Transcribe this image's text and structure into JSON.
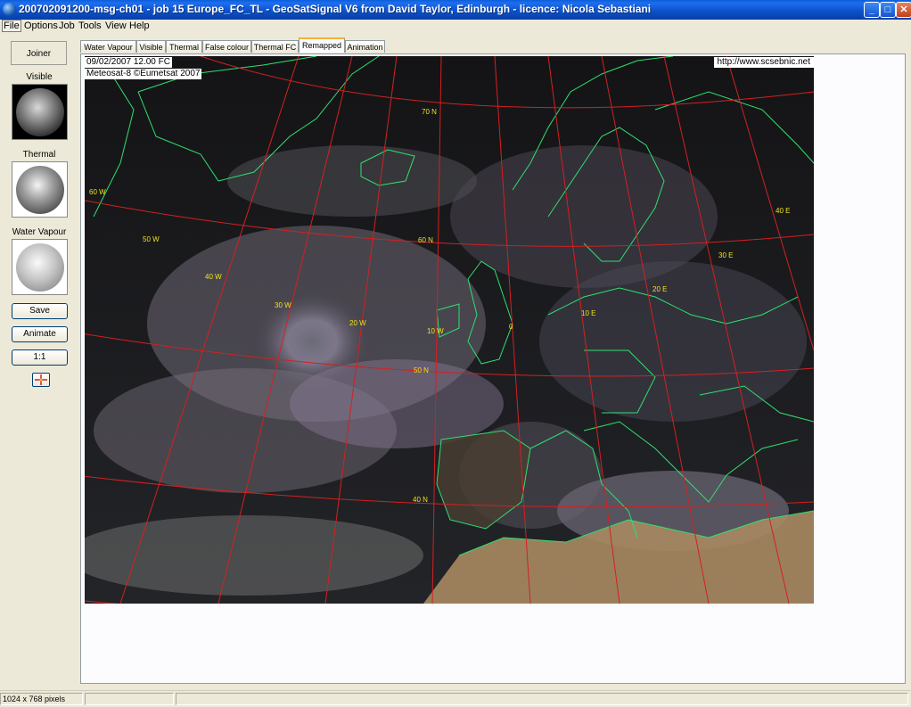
{
  "window": {
    "title": "200702091200-msg-ch01 - job 15 Europe_FC_TL - GeoSatSignal V6 from David Taylor, Edinburgh - licence: Nicola Sebastiani",
    "minimize": "_",
    "maximize": "□",
    "close": "✕"
  },
  "menu": [
    "File",
    "Options",
    "Job",
    "Tools",
    "View",
    "Help"
  ],
  "left_panel": {
    "joiner": "Joiner",
    "thumbnails": [
      "Visible",
      "Thermal",
      "Water Vapour"
    ],
    "buttons": {
      "save": "Save",
      "animate": "Animate",
      "zoom": "1:1"
    }
  },
  "tabs": [
    "Water Vapour",
    "Visible",
    "Thermal",
    "False colour",
    "Thermal FC",
    "Remapped",
    "Animation"
  ],
  "active_tab": "Remapped",
  "image": {
    "timestamp": "09/02/2007 12.00  FC",
    "credit": "Meteosat-8 ©Eumetsat 2007",
    "url": "http://www.scsebnic.net",
    "lat_labels": [
      "70 N",
      "60 N",
      "50 N",
      "40 N"
    ],
    "lon_labels": [
      "60 W",
      "50 W",
      "40 W",
      "30 W",
      "20 W",
      "10 W",
      "0",
      "10 E",
      "20 E",
      "30 E",
      "40 E"
    ]
  },
  "status": {
    "dimensions": "1024 x 768 pixels"
  },
  "colors": {
    "grid": "#d42020",
    "coast": "#2ee070",
    "label": "#f0e020"
  }
}
